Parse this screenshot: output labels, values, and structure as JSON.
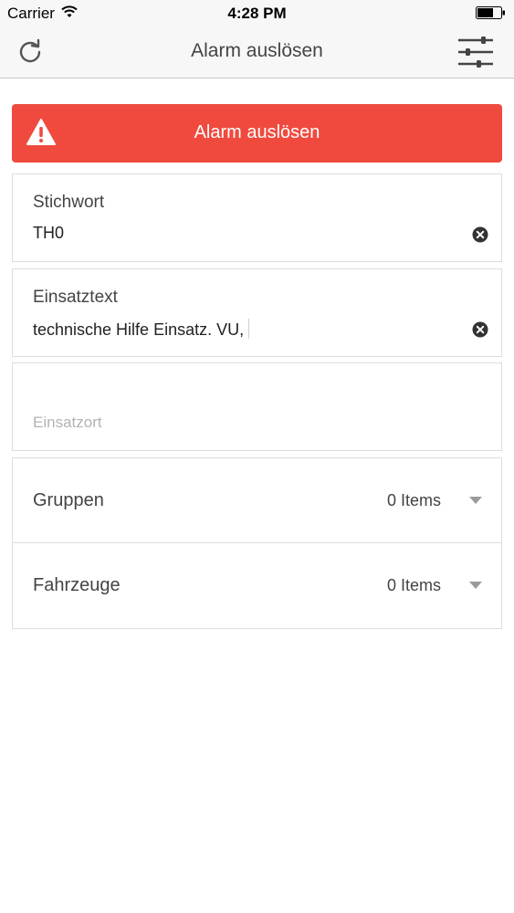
{
  "status_bar": {
    "carrier": "Carrier",
    "time": "4:28 PM"
  },
  "nav": {
    "title": "Alarm auslösen",
    "left_icon": "refresh-icon",
    "right_icon": "filter-sliders-icon"
  },
  "alarm_button": {
    "label": "Alarm auslösen",
    "icon": "warning-icon",
    "color": "#f04a3f"
  },
  "fields": {
    "stichwort": {
      "label": "Stichwort",
      "value": "TH0"
    },
    "einsatztext": {
      "label": "Einsatztext",
      "value": "technische Hilfe Einsatz. VU,"
    },
    "einsatzort": {
      "placeholder": "Einsatzort"
    }
  },
  "selects": {
    "gruppen": {
      "label": "Gruppen",
      "count": "0 Items"
    },
    "fahrzeuge": {
      "label": "Fahrzeuge",
      "count": "0 Items"
    }
  }
}
